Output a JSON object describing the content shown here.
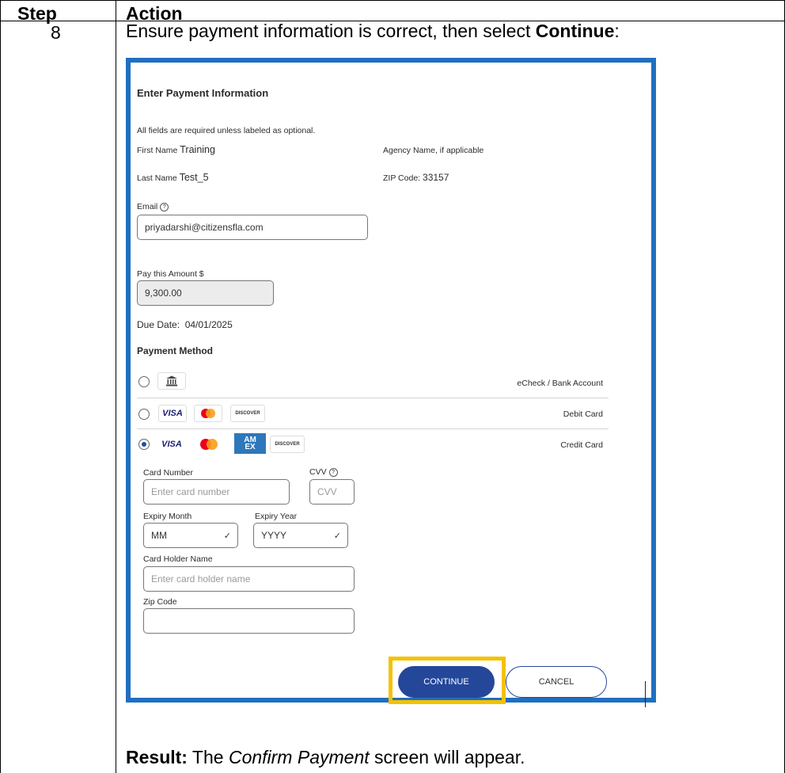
{
  "table": {
    "header_step": "Step",
    "header_action": "Action",
    "step_number": "8",
    "instruction_prefix": "Ensure payment information is correct, then select ",
    "instruction_bold": "Continue",
    "instruction_suffix": ":",
    "result_label": "Result:",
    "result_text_pre": " The ",
    "result_italic": "Confirm Payment",
    "result_text_post": " screen will appear."
  },
  "form": {
    "title": "Enter Payment Information",
    "note": "All fields are required unless labeled as optional.",
    "first_name_label": "First Name",
    "first_name_value": "Training",
    "last_name_label": "Last Name",
    "last_name_value": "Test_5",
    "agency_label": "Agency Name, if applicable",
    "zip_label": "ZIP Code:",
    "zip_value": "33157",
    "email_label": "Email",
    "email_value": "priyadarshi@citizensfla.com",
    "amount_label": "Pay this Amount $",
    "amount_value": "9,300.00",
    "due_date_label": "Due Date:",
    "due_date_value": "04/01/2025",
    "payment_method_label": "Payment Method",
    "methods": [
      {
        "label": "eCheck / Bank Account",
        "selected": false
      },
      {
        "label": "Debit Card",
        "selected": false
      },
      {
        "label": "Credit Card",
        "selected": true
      }
    ],
    "card_number_label": "Card Number",
    "card_number_placeholder": "Enter card number",
    "cvv_label": "CVV",
    "cvv_placeholder": "CVV",
    "expiry_month_label": "Expiry Month",
    "expiry_month_value": "MM",
    "expiry_year_label": "Expiry Year",
    "expiry_year_value": "YYYY",
    "holder_label": "Card Holder Name",
    "holder_placeholder": "Enter card holder name",
    "zipcode_label": "Zip Code",
    "zipcode_value": "",
    "continue_label": "CONTINUE",
    "cancel_label": "CANCEL"
  },
  "logos": {
    "visa": "VISA",
    "discover": "DISCOVER",
    "amex_top": "AM",
    "amex_bottom": "EX"
  },
  "colors": {
    "panel_border": "#1f6fc0",
    "continue_bg": "#25479a",
    "highlight": "#f5c100"
  }
}
